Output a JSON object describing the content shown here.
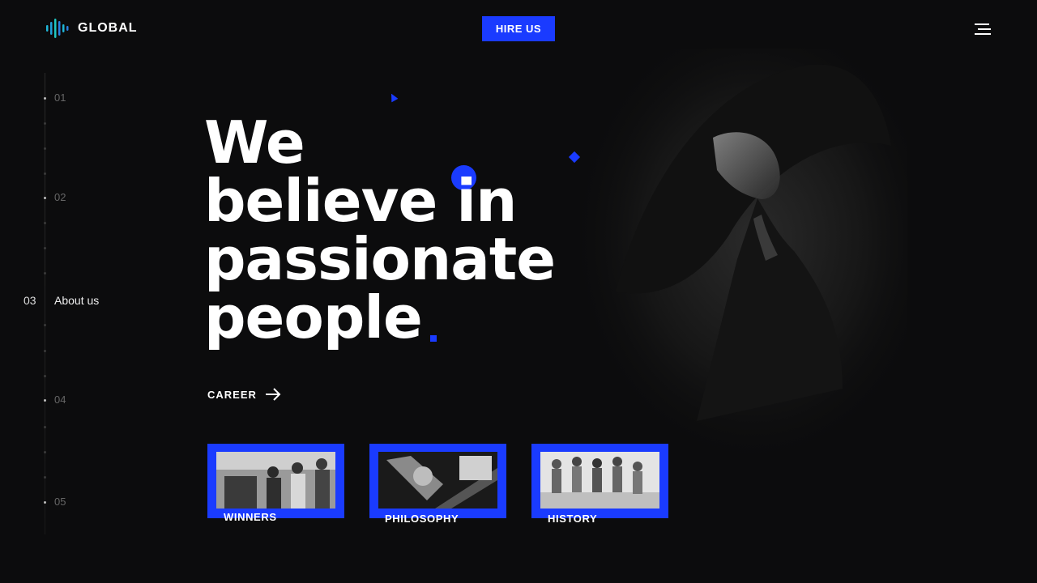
{
  "header": {
    "logo_text": "GLOBAL",
    "hire_label": "HIRE US"
  },
  "side_nav": {
    "items": [
      {
        "number": "01"
      },
      {
        "number": "02"
      },
      {
        "number": "03",
        "label": "About us",
        "active": true
      },
      {
        "number": "04"
      },
      {
        "number": "05"
      }
    ]
  },
  "hero": {
    "lines": [
      "We",
      "believe in",
      "passionate",
      "people"
    ],
    "career_label": "CAREER"
  },
  "cards": [
    {
      "label": "WINNERS"
    },
    {
      "label": "PHILOSOPHY"
    },
    {
      "label": "HISTORY"
    }
  ],
  "colors": {
    "accent": "#1a3bff",
    "background": "#0c0c0d",
    "text": "#ffffff"
  },
  "icons": {
    "logo": "sound-wave-icon",
    "menu": "hamburger-menu-icon",
    "career": "arrow-right-icon"
  }
}
